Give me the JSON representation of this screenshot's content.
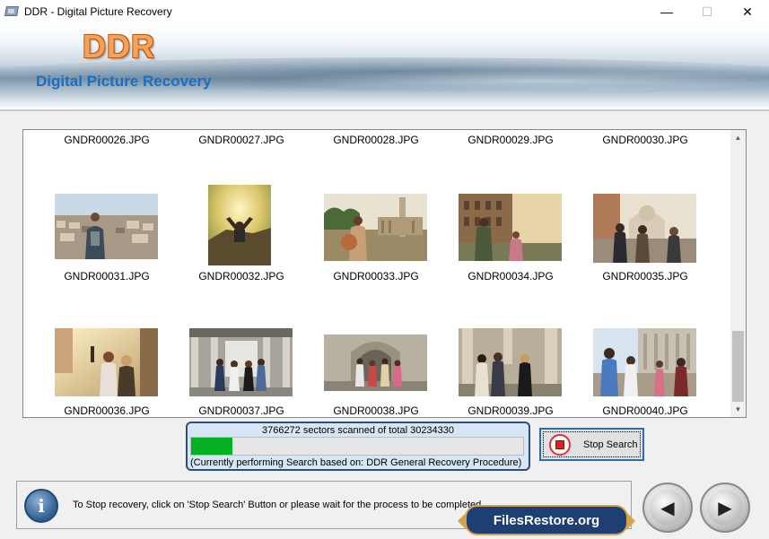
{
  "window": {
    "title": "DDR - Digital Picture Recovery",
    "controls": {
      "minimize": "—",
      "maximize": "☐",
      "close": "✕"
    },
    "icon": "app-disk-icon"
  },
  "banner": {
    "logo": "DDR",
    "subtitle": "Digital Picture Recovery"
  },
  "gallery": {
    "top_row_labels": [
      "GNDR00026.JPG",
      "GNDR00027.JPG",
      "GNDR00028.JPG",
      "GNDR00029.JPG",
      "GNDR00030.JPG"
    ],
    "rows": [
      {
        "items": [
          {
            "label": "GNDR00031.JPG",
            "scene": "city-view"
          },
          {
            "label": "GNDR00032.JPG",
            "scene": "mountain-sunset"
          },
          {
            "label": "GNDR00033.JPG",
            "scene": "ruins-column"
          },
          {
            "label": "GNDR00034.JPG",
            "scene": "colosseum"
          },
          {
            "label": "GNDR00035.JPG",
            "scene": "basilica-group"
          }
        ]
      },
      {
        "items": [
          {
            "label": "GNDR00036.JPG",
            "scene": "selfie-street"
          },
          {
            "label": "GNDR00037.JPG",
            "scene": "arcade-walk"
          },
          {
            "label": "GNDR00038.JPG",
            "scene": "church-door"
          },
          {
            "label": "GNDR00039.JPG",
            "scene": "columns-walk"
          },
          {
            "label": "GNDR00040.JPG",
            "scene": "square-walk"
          }
        ]
      }
    ],
    "scroll": {
      "up": "▲",
      "down": "▼"
    }
  },
  "progress": {
    "scan_text": "3766272 sectors scanned of total 30234330",
    "fraction": 0.1246,
    "procedure_text": "(Currently performing Search based on:  DDR General Recovery Procedure)"
  },
  "stop_button": {
    "label": "Stop Search",
    "icon": "stop-icon"
  },
  "info": {
    "icon_glyph": "i",
    "text": "To Stop recovery, click on 'Stop Search' Button or please wait for the process to be completed."
  },
  "nav": {
    "back": "◀",
    "next": "▶"
  },
  "badge": {
    "text": "FilesRestore.org"
  },
  "colors": {
    "accent_blue": "#1b6fc2",
    "logo_orange": "#f6a25a",
    "progress_green": "#06b025",
    "panel_border": "#2a4f78",
    "badge_bg": "#1d3f73"
  }
}
